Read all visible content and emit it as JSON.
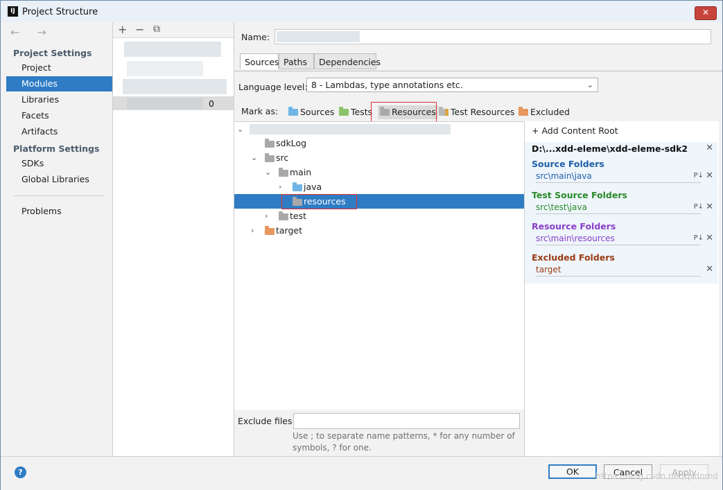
{
  "window": {
    "title": "Project Structure",
    "app_icon_text": "IJ",
    "close_glyph": "✕"
  },
  "nav": {
    "back_forward": "← →",
    "project_settings_header": "Project Settings",
    "project_settings": [
      "Project",
      "Modules",
      "Libraries",
      "Facets",
      "Artifacts"
    ],
    "platform_settings_header": "Platform Settings",
    "platform_settings": [
      "SDKs",
      "Global Libraries"
    ],
    "other": [
      "Problems"
    ],
    "selected": "Modules"
  },
  "modules_panel": {
    "toolbar": {
      "add": "+",
      "remove": "−",
      "copy": "⧉"
    },
    "selected_count": "0"
  },
  "module": {
    "name_label": "Name:",
    "tabs": [
      "Sources",
      "Paths",
      "Dependencies"
    ],
    "active_tab": "Sources",
    "language_level_label": "Language level:",
    "language_level_value": "8 - Lambdas, type annotations etc.",
    "mark_as_label": "Mark as:",
    "mark_as": {
      "sources": "Sources",
      "tests": "Tests",
      "resources": "Resources",
      "test_resources": "Test Resources",
      "excluded": "Excluded"
    },
    "tree": {
      "sdklog": "sdkLog",
      "src": "src",
      "main": "main",
      "java": "java",
      "resources": "resources",
      "test": "test",
      "target": "target"
    },
    "exclude_files_label": "Exclude files:",
    "exclude_files_value": "",
    "hint_1": "Use ; to separate name patterns, * for any number of",
    "hint_2": "symbols, ? for one."
  },
  "content_roots": {
    "add_label": "+ Add Content Root",
    "root_path": "D:\\...xdd-eleme\\xdd-eleme-sdk2",
    "source_header": "Source Folders",
    "source_item": "src\\main\\java",
    "test_header": "Test Source Folders",
    "test_item": "src\\test\\java",
    "resource_header": "Resource Folders",
    "resource_item": "src\\main\\resources",
    "excluded_header": "Excluded Folders",
    "excluded_item": "target",
    "props_glyph": "P↓",
    "remove_glyph": "✕"
  },
  "buttons": {
    "help": "?",
    "ok": "OK",
    "cancel": "Cancel",
    "apply": "Apply"
  },
  "watermark": "https://blog.csdn.net/qsdnmd",
  "colors": {
    "selection": "#2f7cc4",
    "sources_folder": "#6fb6e6",
    "tests_folder": "#8dc26a",
    "resources_folder": "#a9a9a9",
    "excluded_folder": "#e8975f",
    "source_header": "#1f5fa8",
    "test_header": "#2a8a2a",
    "resource_header": "#8a3fc8",
    "excluded_header": "#9b3b12",
    "highlight": "#e12c2c"
  }
}
